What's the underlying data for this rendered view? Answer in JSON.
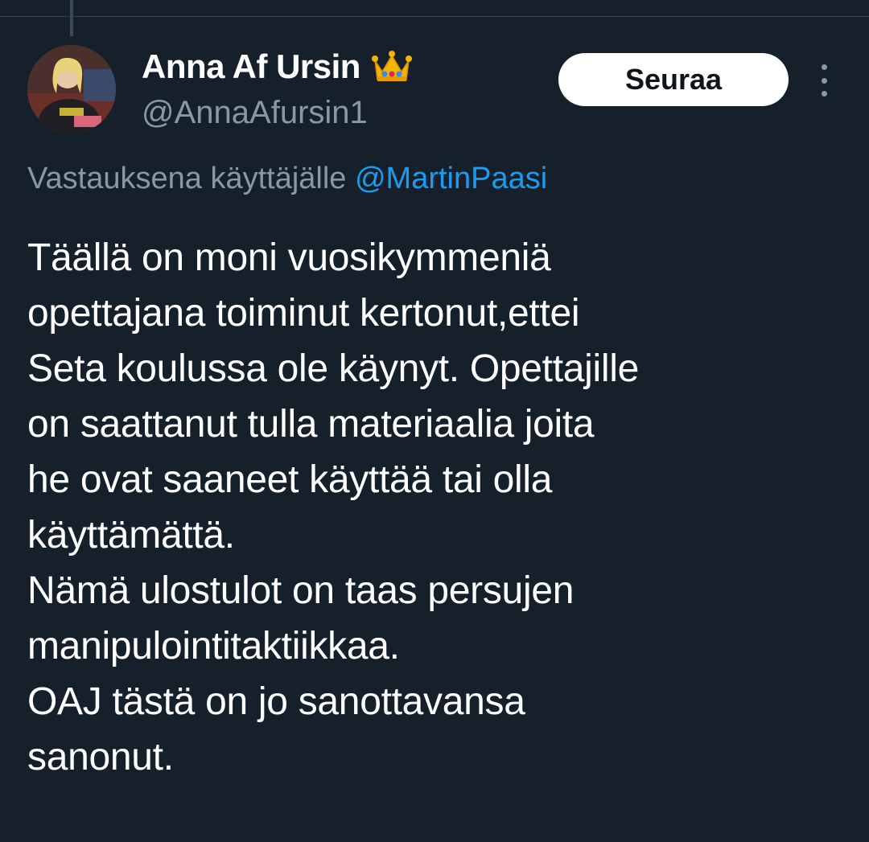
{
  "author": {
    "display_name": "Anna Af Ursin",
    "handle": "@AnnaAfursin1",
    "badge_icon": "crown-emoji-icon",
    "avatar_icon": "profile-photo-avatar"
  },
  "follow_button": {
    "label": "Seuraa"
  },
  "more_menu": {
    "icon": "more-vertical-icon"
  },
  "reply_context": {
    "prefix": "Vastauksena käyttäjälle",
    "mention": "@MartinPaasi"
  },
  "tweet": {
    "lines": [
      "Täällä on moni vuosikymmeniä",
      "opettajana toiminut kertonut,ettei",
      "Seta koulussa ole käynyt. Opettajille",
      "on saattanut tulla materiaalia joita",
      "he ovat saaneet käyttää tai olla",
      "käyttämättä.",
      "Nämä ulostulot on taas persujen",
      "manipulointitaktiikkaa.",
      "OAJ tästä on jo sanottavansa",
      "sanonut."
    ]
  },
  "colors": {
    "background": "#15202b",
    "primary_text": "#ffffff",
    "secondary_text": "#8899a6",
    "link": "#1d9bf0",
    "button_bg": "#ffffff",
    "button_text": "#0f1419"
  }
}
